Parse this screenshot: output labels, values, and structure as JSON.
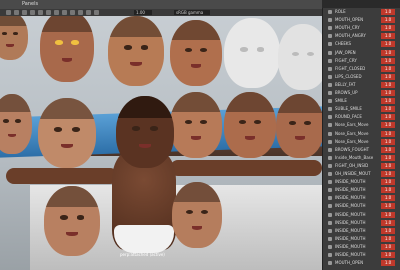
{
  "menubar": {
    "items": [
      "Panels"
    ]
  },
  "toolbar": {
    "field1": "1.00",
    "field2": "sRGB gamma"
  },
  "viewport": {
    "caption": "perp:attached (active)"
  },
  "channel_list": {
    "items": [
      "ROLE",
      "MOUTH_OPEN",
      "MOUTH_CRY",
      "MOUTH_ANGRY",
      "CHEEKS",
      "JAW_OPEN",
      "FIGHT_CRY",
      "FIGHT_CLOSED",
      "LIPS_CLOSED",
      "BELLY_FAT",
      "BROWS_UP",
      "SMILE",
      "SUBLE_SMILE",
      "ROUND_FACE",
      "Nose_Ears_Move",
      "Nose_Ears_Move",
      "Nose_Ears_Move",
      "BROWS_FOUGHT",
      "Inside_Mouth_Base",
      "FIGHT_OH_INSID",
      "OH_INSIDE_MOUT",
      "INSIDE_MOUTH",
      "INSIDE_MOUTH",
      "INSIDE_MOUTH",
      "INSIDE_MOUTH",
      "INSIDE_MOUTH",
      "INSIDE_MOUTH",
      "INSIDE_MOUTH",
      "INSIDE_MOUTH",
      "INSIDE_MOUTH",
      "INSIDE_MOUTH",
      "MOUTH_OPEN"
    ],
    "value": "1.0",
    "accent_color": "#c0392b"
  }
}
